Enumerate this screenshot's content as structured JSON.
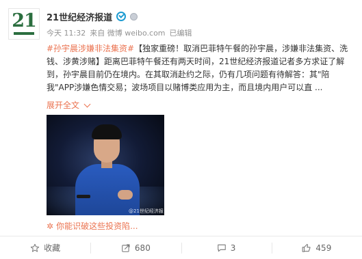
{
  "post": {
    "author": {
      "name": "21世纪经济报道",
      "avatar_text": "21",
      "verified_icon": "verified-badge-icon",
      "medal_icon": "medal-icon"
    },
    "meta": {
      "time": "今天 11:32",
      "source": "来自 微博 weibo.com",
      "edited": "已编辑"
    },
    "content": {
      "hashtag": "#孙宇晨涉嫌非法集资#",
      "text": "【独家重磅！取消巴菲特午餐的孙宇晨，涉嫌非法集资、洗钱、涉黄涉赌】距离巴菲特午餐还有两天时间，21世纪经济报道记者多方求证了解到，孙宇晨目前仍在境内。在其取消赴约之际，仍有几项问题有待解答：其\"陪我\"APP涉嫌色情交易；波场项目以赌博类应用为主，而且境内用户可以直 ..."
    },
    "expand_label": "展开全文",
    "image": {
      "watermark": "@21世纪经济报"
    },
    "link_text": "你能识破这些投资陷..."
  },
  "actions": {
    "favorite_label": "收藏",
    "repost_count": "680",
    "comment_count": "3",
    "like_count": "459"
  },
  "colors": {
    "accent": "#eb7350",
    "brand_green": "#2b6e3f",
    "meta_gray": "#939393"
  }
}
